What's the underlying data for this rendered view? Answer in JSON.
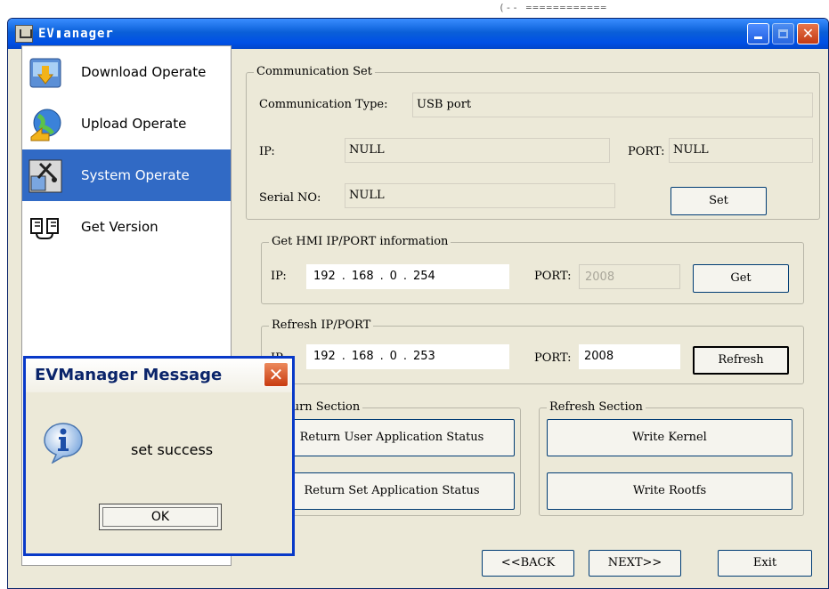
{
  "background": {
    "fragment": "(-- ============"
  },
  "window": {
    "title": "EV▮anager",
    "buttons": {
      "minimize": "",
      "maximize": "",
      "close": "✕"
    }
  },
  "sidebar": {
    "items": [
      {
        "label": "Download Operate",
        "icon": "download-icon"
      },
      {
        "label": "Upload Operate",
        "icon": "upload-globe-icon"
      },
      {
        "label": "System Operate",
        "icon": "system-tools-icon",
        "active": true
      },
      {
        "label": "Get Version",
        "icon": "version-icon"
      }
    ]
  },
  "communication_set": {
    "legend": "Communication Set",
    "type_label": "Communication Type:",
    "type_value": "USB port",
    "ip_label": "IP:",
    "ip_value": "NULL",
    "port_label": "PORT:",
    "port_value": "NULL",
    "serial_label": "Serial NO:",
    "serial_value": "NULL",
    "set_button": "Set"
  },
  "get_hmi": {
    "legend": "Get HMI IP/PORT information",
    "ip_label": "IP:",
    "ip": [
      "192",
      "168",
      "0",
      "254"
    ],
    "port_label": "PORT:",
    "port_value": "2008",
    "get_button": "Get"
  },
  "refresh_ip": {
    "legend": "Refresh IP/PORT",
    "ip_label": "IP:",
    "ip": [
      "192",
      "168",
      "0",
      "253"
    ],
    "port_label": "PORT:",
    "port_value": "2008",
    "refresh_button": "Refresh"
  },
  "return_section": {
    "legend": "Return Section",
    "button1": "Return User Application Status",
    "button2": "Return Set Application Status"
  },
  "refresh_section": {
    "legend": "Refresh Section",
    "button1": "Write Kernel",
    "button2": "Write Rootfs"
  },
  "nav_buttons": {
    "back": "<<BACK",
    "next": "NEXT>>",
    "exit": "Exit"
  },
  "message": {
    "title": "EVManager Message",
    "text": "set success",
    "ok": "OK",
    "close": "✕"
  },
  "colors": {
    "title_blue": "#0050e6",
    "selection": "#316ac5",
    "face": "#ece9d8"
  }
}
